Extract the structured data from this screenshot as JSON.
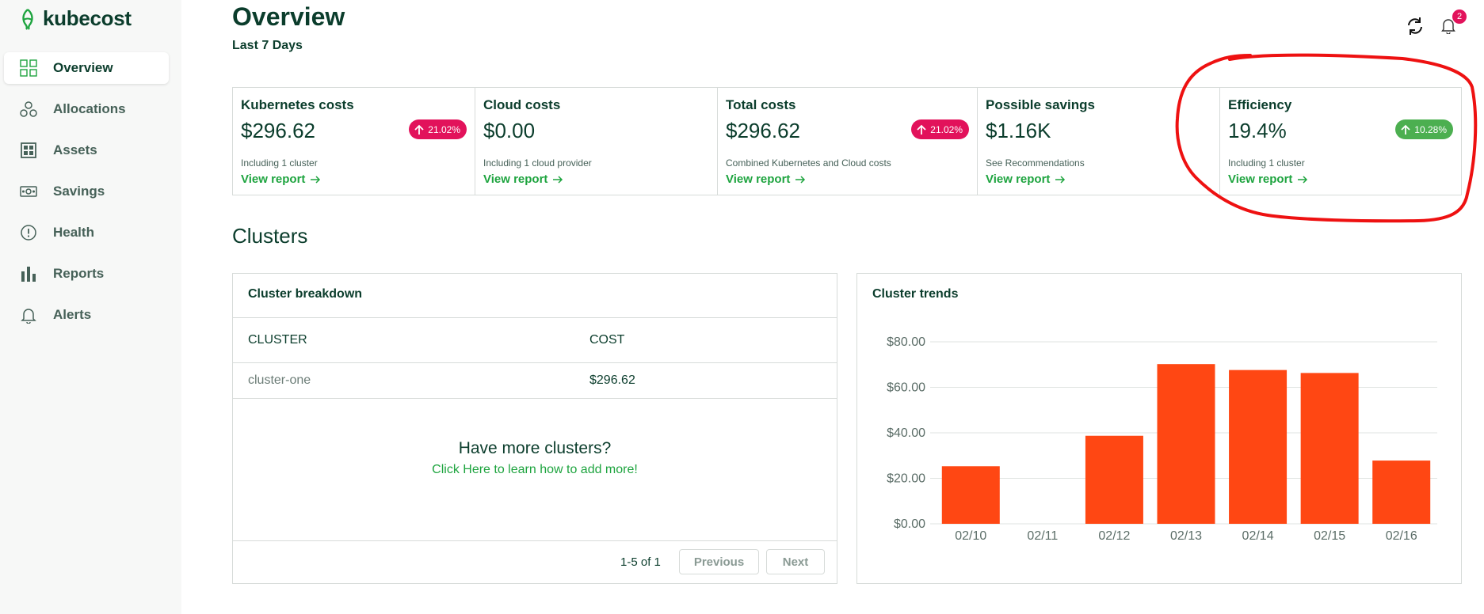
{
  "brand": {
    "name": "kubecost",
    "accent": "#1ea43f",
    "dark": "#0b3d2c"
  },
  "sidebar": {
    "items": [
      {
        "label": "Overview",
        "icon": "grid-icon",
        "active": true
      },
      {
        "label": "Allocations",
        "icon": "allocations-icon",
        "active": false
      },
      {
        "label": "Assets",
        "icon": "assets-icon",
        "active": false
      },
      {
        "label": "Savings",
        "icon": "savings-icon",
        "active": false
      },
      {
        "label": "Health",
        "icon": "health-icon",
        "active": false
      },
      {
        "label": "Reports",
        "icon": "bar-chart-icon",
        "active": false
      },
      {
        "label": "Alerts",
        "icon": "bell-icon",
        "active": false
      }
    ]
  },
  "header": {
    "title": "Overview",
    "subtitle": "Last 7 Days",
    "notification_count": "2"
  },
  "cards": [
    {
      "title": "Kubernetes costs",
      "value": "$296.62",
      "badge": "21.02%",
      "badge_color": "#e2125b",
      "note": "Including 1 cluster",
      "link": "View report"
    },
    {
      "title": "Cloud costs",
      "value": "$0.00",
      "badge": null,
      "note": "Including 1 cloud provider",
      "link": "View report"
    },
    {
      "title": "Total costs",
      "value": "$296.62",
      "badge": "21.02%",
      "badge_color": "#e2125b",
      "note": "Combined Kubernetes and Cloud costs",
      "link": "View report"
    },
    {
      "title": "Possible savings",
      "value": "$1.16K",
      "badge": null,
      "note": "See Recommendations",
      "link": "View report"
    },
    {
      "title": "Efficiency",
      "value": "19.4%",
      "badge": "10.28%",
      "badge_color": "#4caf50",
      "note": "Including 1 cluster",
      "link": "View report"
    }
  ],
  "clusters": {
    "section_title": "Clusters",
    "breakdown": {
      "title": "Cluster breakdown",
      "columns": [
        "CLUSTER",
        "COST"
      ],
      "rows": [
        {
          "cluster": "cluster-one",
          "cost": "$296.62"
        }
      ],
      "more_title": "Have more clusters?",
      "more_link": "Click Here to learn how to add more!",
      "pagination": "1-5 of 1",
      "prev_label": "Previous",
      "next_label": "Next"
    },
    "trends": {
      "title": "Cluster trends"
    }
  },
  "chart_data": {
    "type": "bar",
    "title": "Cluster trends",
    "categories": [
      "02/10",
      "02/11",
      "02/12",
      "02/13",
      "02/14",
      "02/15",
      "02/16"
    ],
    "values": [
      25.3,
      0,
      38.7,
      70.2,
      67.6,
      66.3,
      27.8
    ],
    "ylim": [
      0,
      80
    ],
    "yticks": [
      0,
      20,
      40,
      60,
      80
    ],
    "ytick_labels": [
      "$0.00",
      "$20.00",
      "$40.00",
      "$60.00",
      "$80.00"
    ],
    "bar_color": "#ff4713",
    "grid": true
  },
  "annotation_color": "#ee1111"
}
